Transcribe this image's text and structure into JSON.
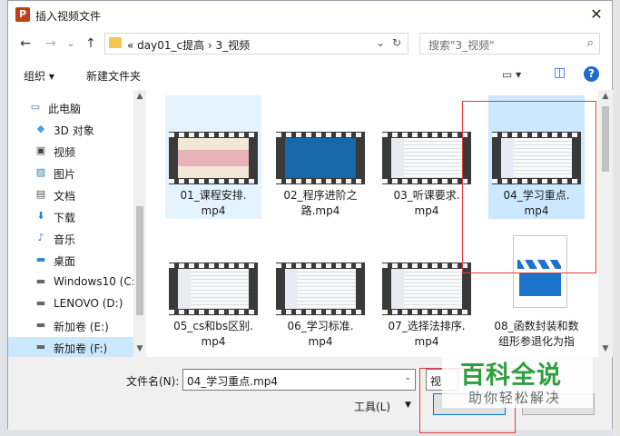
{
  "dialog": {
    "title": "插入视频文件",
    "app_icon_letter": "P",
    "close_glyph": "✕"
  },
  "nav": {
    "back": "←",
    "forward": "→",
    "down": "⌄",
    "up": "↑",
    "breadcrumb": "«   day01_c提高  ›  3_视频",
    "dropdown": "⌄",
    "refresh": "↻",
    "search_placeholder": "搜索\"3_视频\"",
    "search_icon": "⌕"
  },
  "toolbar": {
    "organize": "组织 ▾",
    "new_folder": "新建文件夹",
    "view_icon": "▭ ▾",
    "pane_icon": "◫",
    "help": "?"
  },
  "sidebar": {
    "items": [
      {
        "label": "此电脑",
        "icon": "pc-icon",
        "glyph": "▭",
        "color": "#2a7ad3"
      },
      {
        "label": "3D 对象",
        "icon": "cube-icon",
        "glyph": "◆",
        "color": "#4aa0e0"
      },
      {
        "label": "视频",
        "icon": "film-icon",
        "glyph": "▣",
        "color": "#444"
      },
      {
        "label": "图片",
        "icon": "picture-icon",
        "glyph": "▨",
        "color": "#3c7fb0"
      },
      {
        "label": "文档",
        "icon": "document-icon",
        "glyph": "▤",
        "color": "#555"
      },
      {
        "label": "下载",
        "icon": "download-icon",
        "glyph": "⬇",
        "color": "#2a7ad3"
      },
      {
        "label": "音乐",
        "icon": "music-icon",
        "glyph": "♪",
        "color": "#2a7ad3"
      },
      {
        "label": "桌面",
        "icon": "desktop-icon",
        "glyph": "▬",
        "color": "#2a8ad8"
      },
      {
        "label": "Windows10 (C:",
        "icon": "drive-icon",
        "glyph": "▬",
        "color": "#666"
      },
      {
        "label": "LENOVO (D:)",
        "icon": "drive-icon",
        "glyph": "▬",
        "color": "#666"
      },
      {
        "label": "新加卷 (E:)",
        "icon": "drive-icon",
        "glyph": "▬",
        "color": "#666"
      },
      {
        "label": "新加卷 (F:)",
        "icon": "drive-icon",
        "glyph": "▬",
        "color": "#666"
      }
    ]
  },
  "files": [
    {
      "line1": "01_课程安排.",
      "line2": "mp4"
    },
    {
      "line1": "02_程序进阶之",
      "line2": "路.mp4"
    },
    {
      "line1": "03_听课要求.",
      "line2": "mp4"
    },
    {
      "line1": "04_学习重点.",
      "line2": "mp4"
    },
    {
      "line1": "05_cs和bs区别.",
      "line2": "mp4"
    },
    {
      "line1": "06_学习标准.",
      "line2": "mp4"
    },
    {
      "line1": "07_选择法排序.",
      "line2": "mp4"
    },
    {
      "line1": "08_函数封装和数",
      "line2": "组形参退化为指"
    }
  ],
  "bottom": {
    "filename_label": "文件名(N):",
    "filename_value": "04_学习重点.mp4",
    "type_partial": "视",
    "tools": "工具(L)",
    "tools_arrow": "▼"
  },
  "watermark": {
    "main": "百科全说",
    "sub": "助你轻松解决"
  },
  "colors": {
    "selection": "#cce8ff",
    "accent": "#0078d7",
    "annotation_red": "#e03c3c",
    "watermark_green": "#2f9e3f"
  }
}
